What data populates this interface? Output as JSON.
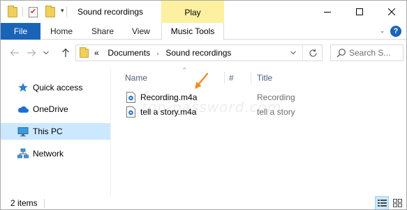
{
  "window": {
    "title": "Sound recordings",
    "contextual_tab_header": "Play",
    "accent_color": "#1a64b8",
    "contextual_color": "#fdf0a0",
    "controls": {
      "minimize": "minimize-icon",
      "maximize": "maximize-icon",
      "close": "close-icon"
    }
  },
  "ribbon": {
    "tabs": [
      "File",
      "Home",
      "Share",
      "View",
      "Music Tools"
    ],
    "help_label": "?"
  },
  "address": {
    "overflow": "«",
    "crumbs": [
      "Documents",
      "Sound recordings"
    ],
    "separator": "›"
  },
  "search": {
    "placeholder": "Search S..."
  },
  "nav_pane": {
    "items": [
      {
        "label": "Quick access",
        "icon": "star-icon",
        "selected": false
      },
      {
        "label": "OneDrive",
        "icon": "cloud-icon",
        "selected": false
      },
      {
        "label": "This PC",
        "icon": "computer-icon",
        "selected": true
      },
      {
        "label": "Network",
        "icon": "network-icon",
        "selected": false
      }
    ]
  },
  "columns": {
    "name": "Name",
    "number": "#",
    "title": "Title",
    "sorted": "name",
    "sort_direction": "ascending"
  },
  "files": [
    {
      "name": "Recording.m4a",
      "title": "Recording",
      "icon": "audio-file-icon"
    },
    {
      "name": "tell a story.m4a",
      "title": "tell a story",
      "icon": "audio-file-icon"
    }
  ],
  "watermark": "top-password.com",
  "annotation_color": "#f08a24",
  "status": {
    "item_count": "2 items"
  }
}
